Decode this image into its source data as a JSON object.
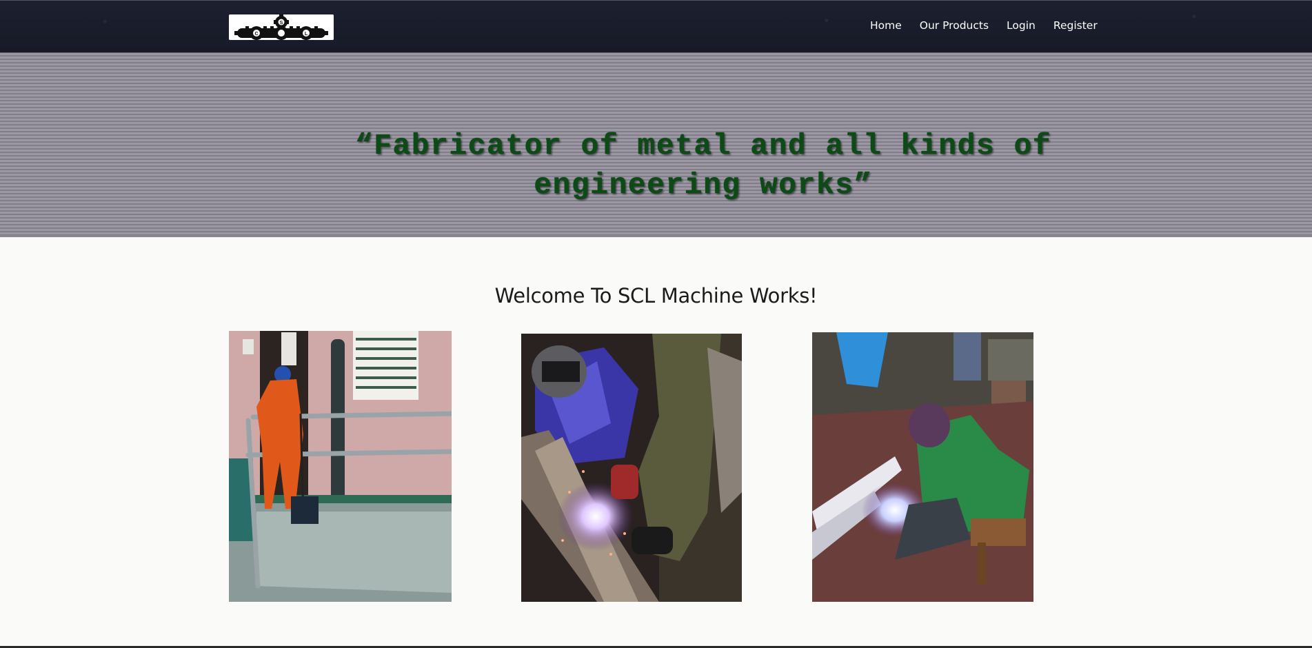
{
  "header": {
    "logo_icon": "gears-logo-icon",
    "logo_letters": [
      "S",
      "C",
      "L"
    ],
    "nav": [
      {
        "label": "Home"
      },
      {
        "label": "Our Products"
      },
      {
        "label": "Login"
      },
      {
        "label": "Register"
      }
    ]
  },
  "hero": {
    "line1": "“Fabricator of metal and all kinds of",
    "line2": "engineering works”",
    "text_color": "#0c4a16"
  },
  "main": {
    "welcome": "Welcome To SCL Machine Works!"
  },
  "colors": {
    "navbar": "#1a1e2c",
    "hero": "#96939f",
    "page": "#fafaf8"
  }
}
